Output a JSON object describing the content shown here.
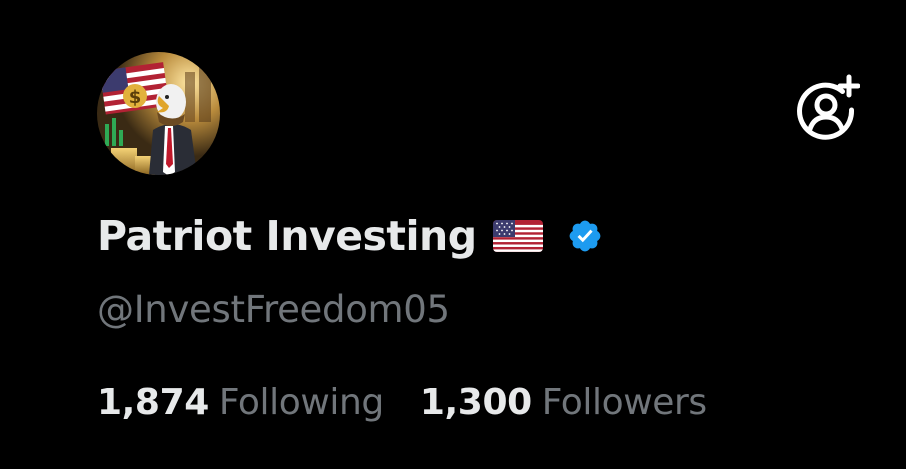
{
  "profile": {
    "display_name": "Patriot Investing",
    "handle": "@InvestFreedom05",
    "flag_icon": "us-flag-icon",
    "verified_icon": "verified-badge-icon",
    "verified_color": "#1d9bf0"
  },
  "actions": {
    "follow_icon": "add-user-icon"
  },
  "stats": {
    "following_count": "1,874",
    "following_label": "Following",
    "followers_count": "1,300",
    "followers_label": "Followers"
  },
  "colors": {
    "background": "#000000",
    "primary_text": "#e7e9ea",
    "secondary_text": "#71767b"
  }
}
